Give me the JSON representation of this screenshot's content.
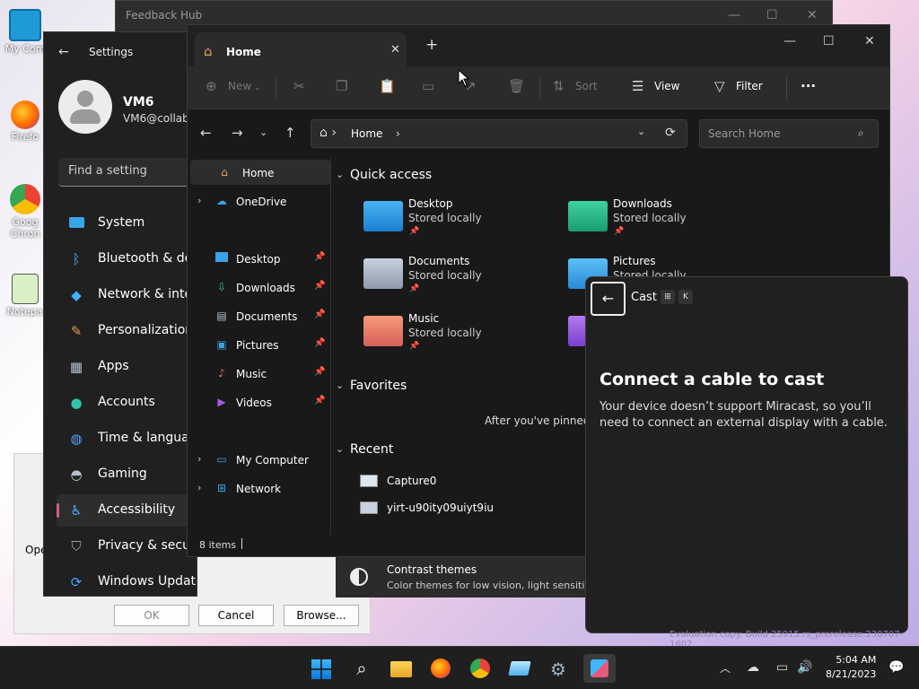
{
  "desktop": {
    "icons": [
      "My Com",
      "Firefo",
      "Goog Chron",
      "Notepa"
    ],
    "watermark": "Evaluation copy. Build 25915.rs_prerelease.230707-1602"
  },
  "back_dialog": {
    "open_label": "Ope",
    "ok": "OK",
    "cancel": "Cancel",
    "browse": "Browse..."
  },
  "feedback_hub": {
    "title": "Feedback Hub"
  },
  "settings": {
    "title": "Settings",
    "user_name": "VM6",
    "user_email": "VM6@collabr",
    "search_placeholder": "Find a setting",
    "nav": [
      {
        "label": "System",
        "icon": "monitor-icon"
      },
      {
        "label": "Bluetooth & dev",
        "icon": "bluetooth-icon"
      },
      {
        "label": "Network & inter",
        "icon": "wifi-icon"
      },
      {
        "label": "Personalization",
        "icon": "brush-icon"
      },
      {
        "label": "Apps",
        "icon": "apps-icon"
      },
      {
        "label": "Accounts",
        "icon": "person-icon"
      },
      {
        "label": "Time & languag",
        "icon": "globe-icon"
      },
      {
        "label": "Gaming",
        "icon": "gamepad-icon"
      },
      {
        "label": "Accessibility",
        "icon": "accessibility-icon",
        "active": true
      },
      {
        "label": "Privacy & securi",
        "icon": "shield-icon"
      },
      {
        "label": "Windows Update",
        "icon": "update-icon"
      }
    ]
  },
  "explorer": {
    "tab_label": "Home",
    "toolbar": {
      "new": "New",
      "sort": "Sort",
      "view": "View",
      "filter": "Filter"
    },
    "breadcrumb": "Home",
    "search_placeholder": "Search Home",
    "sidebar": {
      "home": "Home",
      "onedrive": "OneDrive",
      "pinned": [
        "Desktop",
        "Downloads",
        "Documents",
        "Pictures",
        "Music",
        "Videos"
      ],
      "my_computer": "My Computer",
      "network": "Network"
    },
    "quick_access_title": "Quick access",
    "quick_access": [
      {
        "name": "Desktop",
        "sub": "Stored locally"
      },
      {
        "name": "Downloads",
        "sub": "Stored locally"
      },
      {
        "name": "Documents",
        "sub": "Stored locally"
      },
      {
        "name": "Pictures",
        "sub": "Stored locally"
      },
      {
        "name": "Music",
        "sub": "Stored locally"
      }
    ],
    "favorites_title": "Favorites",
    "favorites_empty": "After you've pinned so",
    "recent_title": "Recent",
    "recent": [
      "Capture0",
      "yirt-u90ity09uiyt9iu"
    ],
    "status": "8 items"
  },
  "contrast": {
    "title": "Contrast themes",
    "subtitle": "Color themes for low vision, light sensitiv"
  },
  "cast": {
    "title": "Cast",
    "key1": "⊞",
    "key2": "K",
    "heading": "Connect a cable to cast",
    "body": "Your device doesn’t support Miracast, so you’ll need to connect an external display with a cable."
  },
  "taskbar": {
    "time": "5:04 AM",
    "date": "8/21/2023"
  }
}
